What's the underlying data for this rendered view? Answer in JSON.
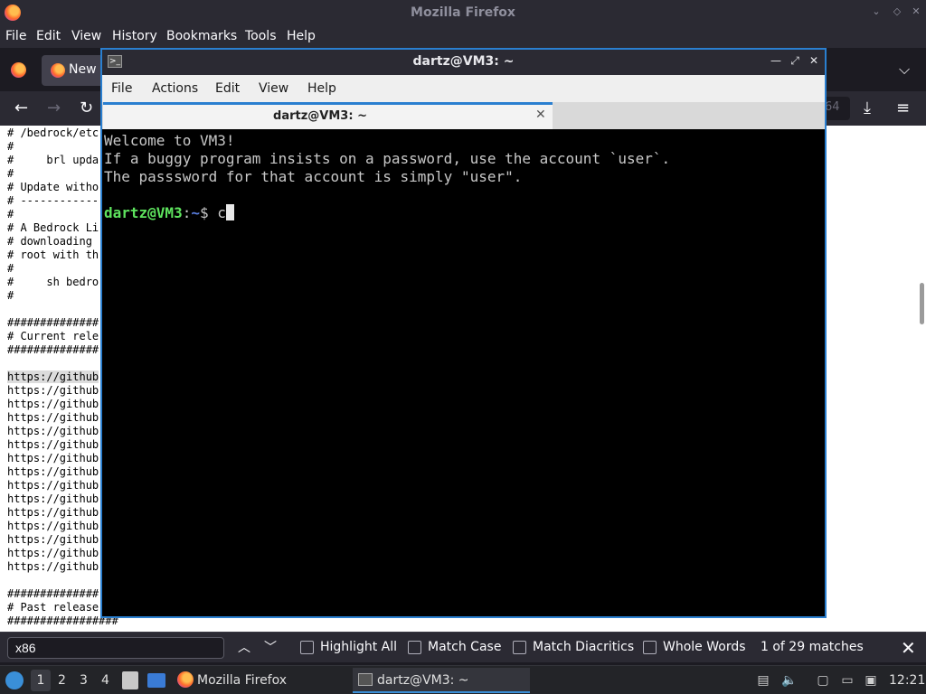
{
  "firefox": {
    "title": "Mozilla Firefox",
    "menu": [
      "File",
      "Edit",
      "View",
      "History",
      "Bookmarks",
      "Tools",
      "Help"
    ],
    "tab_label": "New",
    "url_fragment": "64",
    "content_lines": [
      "# /bedrock/etc",
      "#",
      "#     brl upda",
      "#",
      "# Update witho",
      "# ------------",
      "#",
      "# A Bedrock Li",
      "# downloading ",
      "# root with th",
      "#",
      "#     sh bedro",
      "#",
      "",
      "##############",
      "# Current rele",
      "##############",
      "",
      "https://github",
      "https://github",
      "https://github",
      "https://github",
      "https://github",
      "https://github",
      "https://github",
      "https://github",
      "https://github",
      "https://github",
      "https://github",
      "https://github",
      "https://github",
      "https://github",
      "https://github",
      "",
      "##############",
      "# Past release",
      "#################"
    ],
    "find": {
      "value": "x86",
      "highlight_all": "Highlight All",
      "match_case": "Match Case",
      "match_diacritics": "Match Diacritics",
      "whole_words": "Whole Words",
      "count": "1 of 29 matches"
    }
  },
  "terminal": {
    "title": "dartz@VM3: ~",
    "menu": [
      "File",
      "Actions",
      "Edit",
      "View",
      "Help"
    ],
    "tab_label": "dartz@VM3: ~",
    "lines": [
      "Welcome to VM3!",
      "If a buggy program insists on a password, use the account `user`.",
      "The passsword for that account is simply \"user\"."
    ],
    "prompt_user": "dartz@VM3",
    "prompt_sep": ":",
    "prompt_dir": "~",
    "prompt_symbol": "$ ",
    "typed": "c"
  },
  "taskbar": {
    "workspaces": [
      "1",
      "2",
      "3",
      "4"
    ],
    "firefox_label": "Mozilla Firefox",
    "terminal_label": "dartz@VM3: ~",
    "clock": "12:21"
  }
}
